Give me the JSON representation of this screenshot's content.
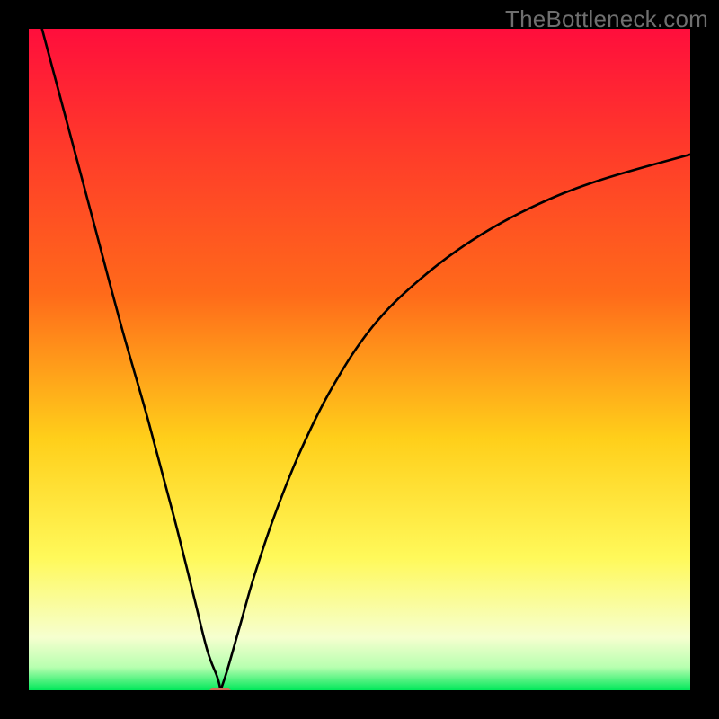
{
  "watermark": "TheBottleneck.com",
  "colors": {
    "frame": "#000000",
    "gradient_top": "#ff0e3c",
    "gradient_upper_mid": "#ff6a1a",
    "gradient_mid": "#ffcf1a",
    "gradient_lower_mid": "#fff95a",
    "gradient_pale": "#f6ffcf",
    "gradient_bottom": "#00e85a",
    "curve": "#000000",
    "marker": "#cc6d56"
  },
  "chart_data": {
    "type": "line",
    "title": "",
    "xlabel": "",
    "ylabel": "",
    "xlim": [
      0,
      100
    ],
    "ylim": [
      0,
      100
    ],
    "min_x": 29,
    "series": [
      {
        "name": "left-branch",
        "x": [
          2,
          6,
          10,
          14,
          18,
          22,
          25,
          27,
          28.5,
          29
        ],
        "values": [
          100,
          85,
          70,
          55,
          41,
          26,
          14,
          6,
          2,
          0
        ]
      },
      {
        "name": "right-branch",
        "x": [
          29,
          30,
          32,
          34,
          37,
          41,
          46,
          52,
          59,
          67,
          76,
          86,
          100
        ],
        "values": [
          0,
          3,
          10,
          17,
          26,
          36,
          46,
          55,
          62,
          68,
          73,
          77,
          81
        ]
      }
    ],
    "marker": {
      "x": 29,
      "y": 0
    }
  }
}
